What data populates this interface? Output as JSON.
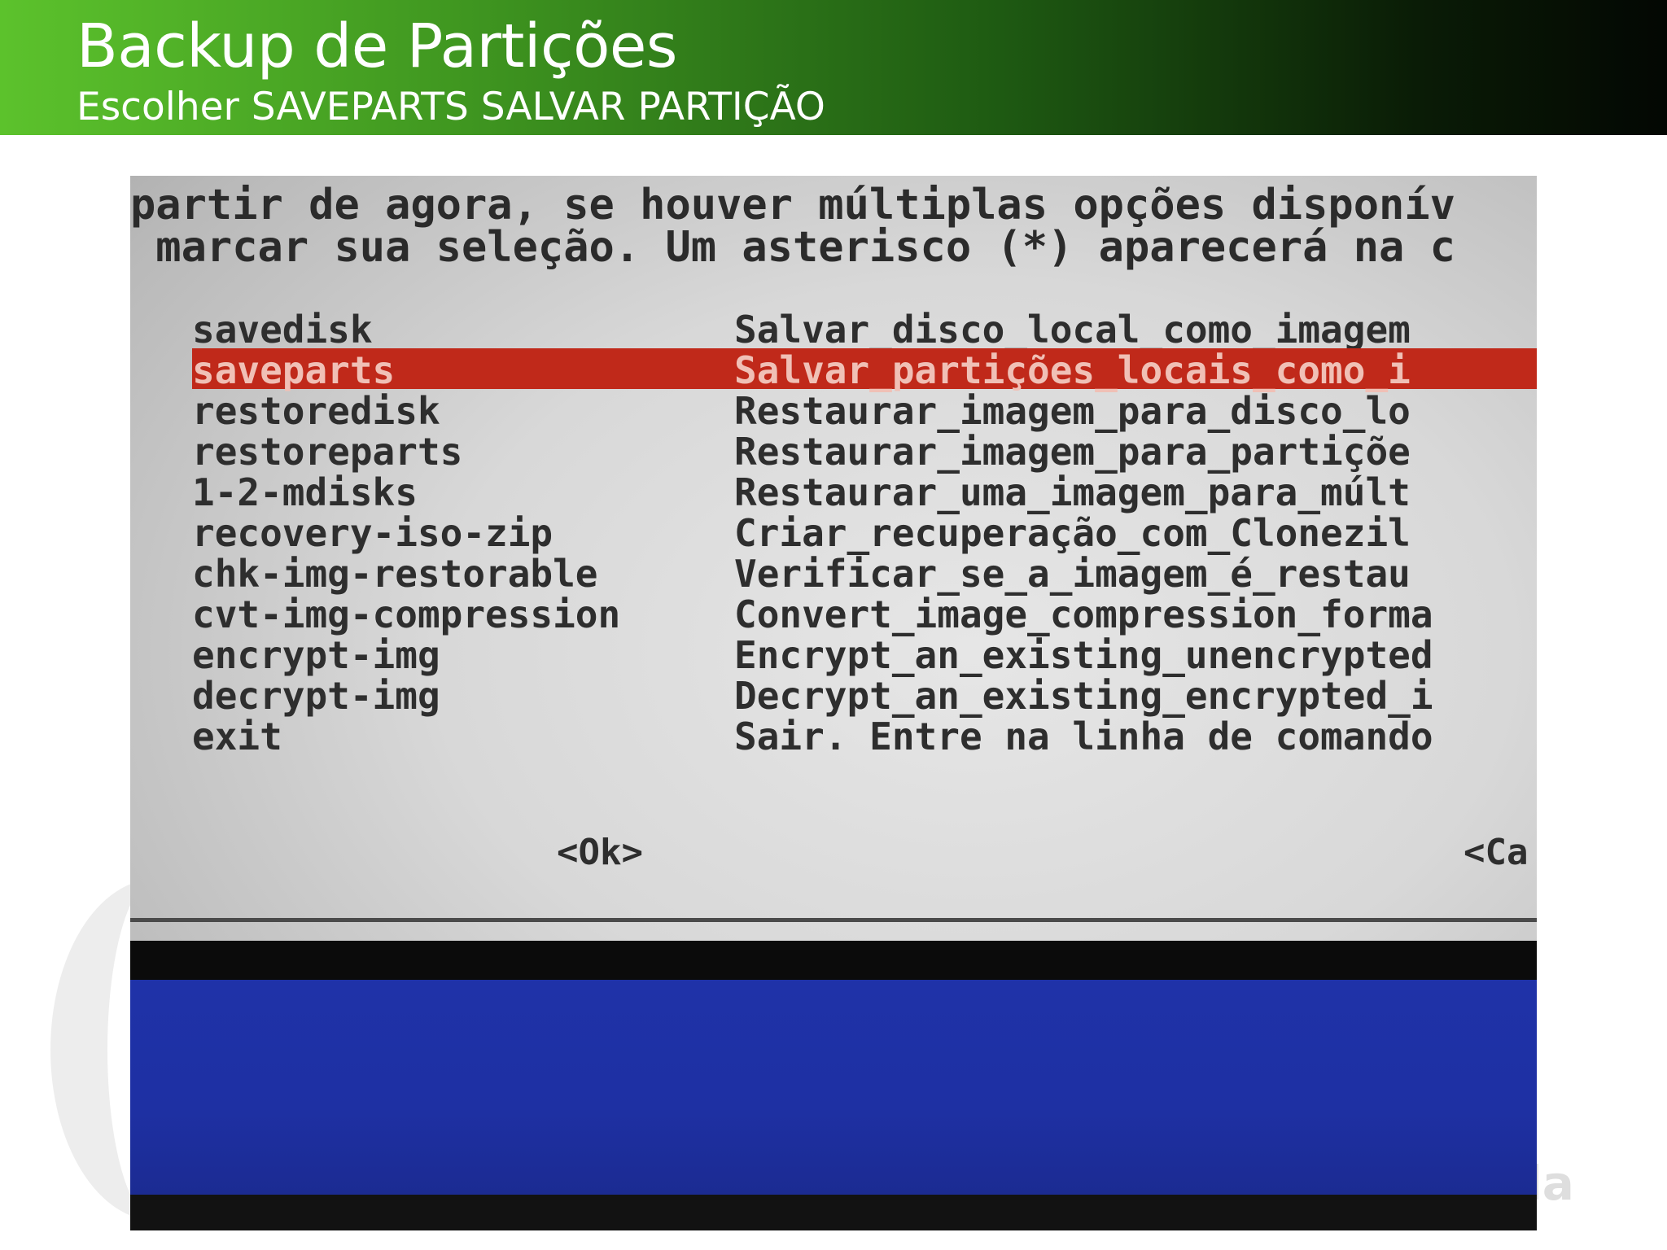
{
  "slide": {
    "title": "Backup de Partições",
    "subtitle": "Escolher SAVEPARTS SALVAR PARTIÇÃO",
    "accent_color": "#5cc22c"
  },
  "terminal": {
    "intro_lines": [
      "partir de agora, se houver múltiplas opções disponív",
      " marcar sua seleção. Um asterisco (*) aparecerá na c"
    ],
    "menu": [
      {
        "tag": "savedisk",
        "desc": "Salvar_disco_local_como_imagem"
      },
      {
        "tag": "saveparts",
        "desc": "Salvar_partições_locais_como_i",
        "selected": true
      },
      {
        "tag": "restoredisk",
        "desc": "Restaurar_imagem_para_disco_lo"
      },
      {
        "tag": "restoreparts",
        "desc": "Restaurar_imagem_para_partiçõe"
      },
      {
        "tag": "1-2-mdisks",
        "desc": "Restaurar_uma_imagem_para_múlt"
      },
      {
        "tag": "recovery-iso-zip",
        "desc": "Criar_recuperação_com_Clonezil"
      },
      {
        "tag": "chk-img-restorable",
        "desc": "Verificar_se_a_imagem_é_restau"
      },
      {
        "tag": "cvt-img-compression",
        "desc": "Convert_image_compression_forma"
      },
      {
        "tag": "encrypt-img",
        "desc": "Encrypt_an_existing_unencrypted"
      },
      {
        "tag": "decrypt-img",
        "desc": "Decrypt_an_existing_encrypted_i"
      },
      {
        "tag": "exit",
        "desc": "Sair. Entre na linha de comando"
      }
    ],
    "ok_button": "<Ok>",
    "cancel_button": "<Ca",
    "selection_color": "#c0291a",
    "bottom_color": "#1f32a8"
  }
}
